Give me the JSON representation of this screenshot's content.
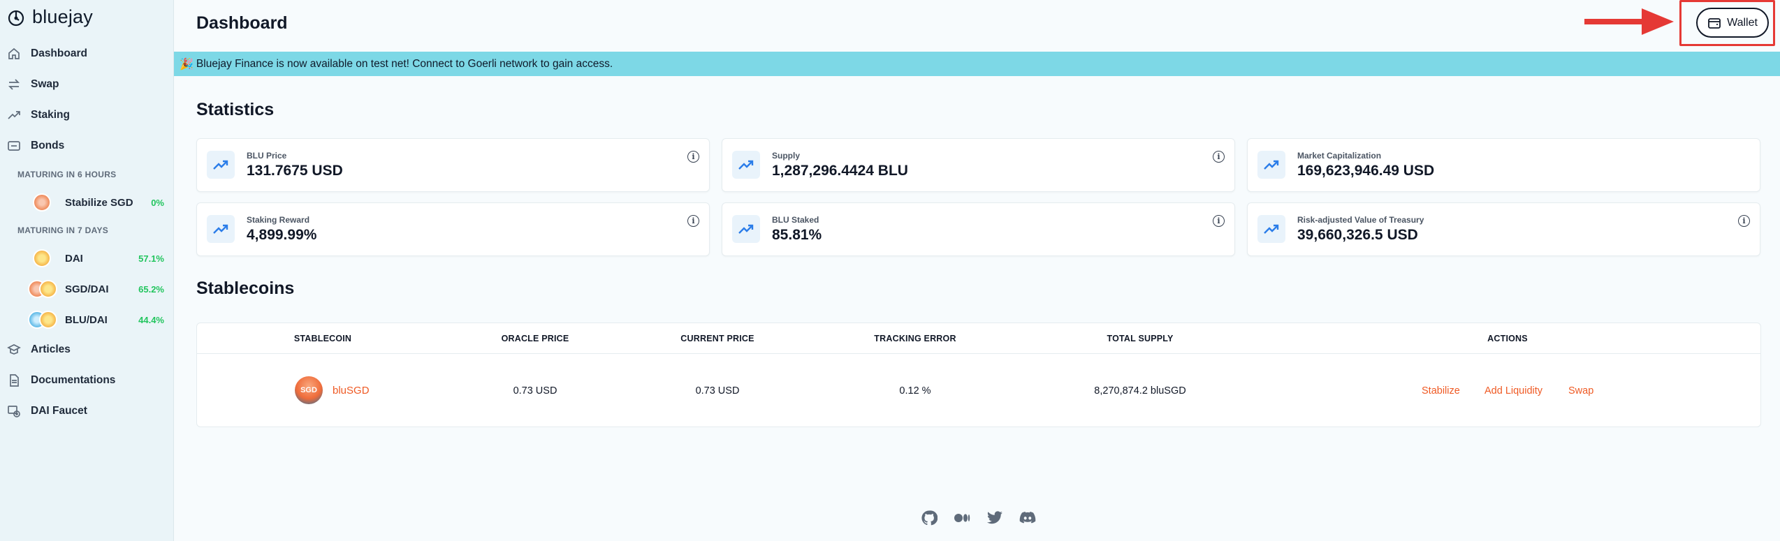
{
  "brand": {
    "name": "bluejay"
  },
  "sidebar": {
    "nav": [
      {
        "label": "Dashboard",
        "icon": "home-icon"
      },
      {
        "label": "Swap",
        "icon": "swap-icon"
      },
      {
        "label": "Staking",
        "icon": "trend-icon"
      },
      {
        "label": "Bonds",
        "icon": "bond-icon"
      }
    ],
    "sections": [
      {
        "label": "MATURING IN 6 HOURS"
      },
      {
        "label": "MATURING IN 7 DAYS"
      }
    ],
    "bonds": [
      {
        "name": "Stabilize SGD",
        "pct": "0%"
      },
      {
        "name": "DAI",
        "pct": "57.1%"
      },
      {
        "name": "SGD/DAI",
        "pct": "65.2%"
      },
      {
        "name": "BLU/DAI",
        "pct": "44.4%"
      }
    ],
    "bottom_nav": [
      {
        "label": "Articles",
        "icon": "articles-icon"
      },
      {
        "label": "Documentations",
        "icon": "document-icon"
      },
      {
        "label": "DAI Faucet",
        "icon": "faucet-icon"
      }
    ]
  },
  "header": {
    "title": "Dashboard",
    "wallet_label": "Wallet"
  },
  "banner": {
    "emoji": "🎉",
    "text": "Bluejay Finance is now available on test net! Connect to Goerli network to gain access."
  },
  "statistics": {
    "title": "Statistics",
    "cards": [
      {
        "label": "BLU Price",
        "value": "131.7675 USD",
        "info": true
      },
      {
        "label": "Supply",
        "value": "1,287,296.4424 BLU",
        "info": true
      },
      {
        "label": "Market Capitalization",
        "value": "169,623,946.49 USD",
        "info": false
      },
      {
        "label": "Staking Reward",
        "value": "4,899.99%",
        "info": true
      },
      {
        "label": "BLU Staked",
        "value": "85.81%",
        "info": true
      },
      {
        "label": "Risk-adjusted Value of Treasury",
        "value": "39,660,326.5 USD",
        "info": true
      }
    ],
    "info_glyph": "i"
  },
  "stablecoins": {
    "title": "Stablecoins",
    "headers": [
      "STABLECOIN",
      "ORACLE PRICE",
      "CURRENT PRICE",
      "TRACKING ERROR",
      "TOTAL SUPPLY",
      "ACTIONS"
    ],
    "rows": [
      {
        "coin_badge": "SGD",
        "name": "bluSGD",
        "oracle_price": "0.73 USD",
        "current_price": "0.73 USD",
        "tracking_error": "0.12 %",
        "total_supply": "8,270,874.2 bluSGD",
        "actions": [
          "Stabilize",
          "Add Liquidity",
          "Swap"
        ]
      }
    ]
  },
  "footer": {
    "icons": [
      "github-icon",
      "medium-icon",
      "twitter-icon",
      "discord-icon"
    ]
  },
  "colors": {
    "accent": "#ef5a24",
    "banner": "#7dd8e6",
    "positive": "#22c55e",
    "highlight": "#e53935"
  }
}
